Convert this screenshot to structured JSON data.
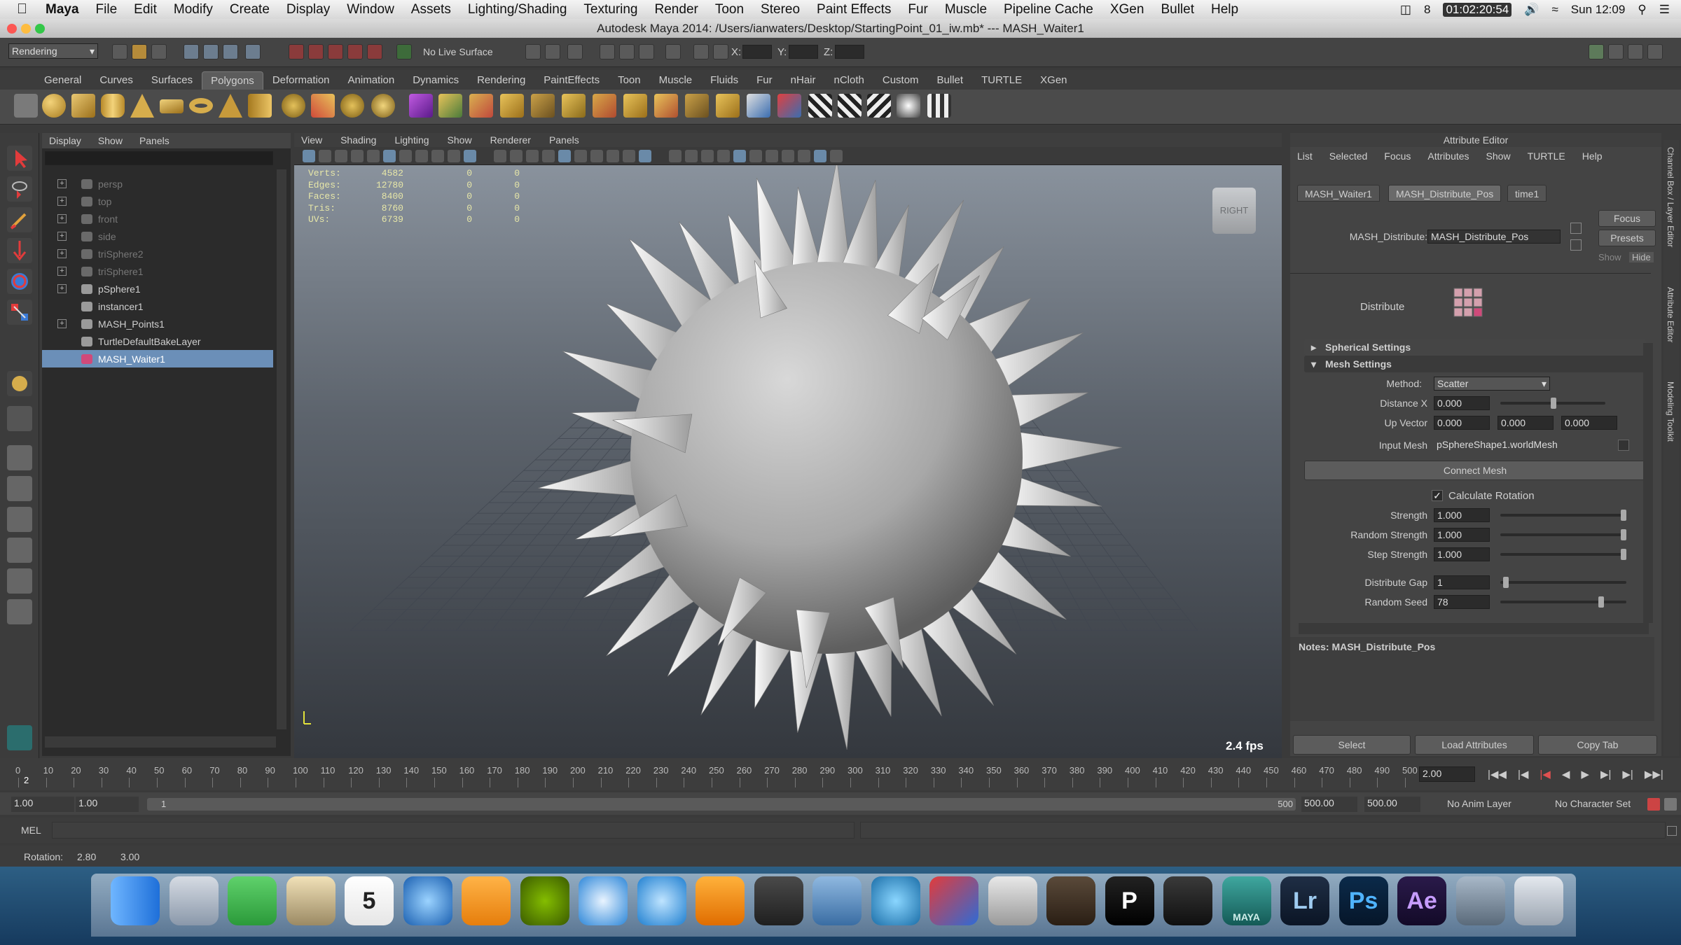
{
  "mac_menubar": {
    "apple_icon": "apple-icon",
    "items": [
      "Maya",
      "File",
      "Edit",
      "Modify",
      "Create",
      "Display",
      "Window",
      "Assets",
      "Lighting/Shading",
      "Texturing",
      "Render",
      "Toon",
      "Stereo",
      "Paint Effects",
      "Fur",
      "Muscle",
      "Pipeline Cache",
      "XGen",
      "Bullet",
      "Help"
    ],
    "status": {
      "badge": "8",
      "timer": "01:02:20:54",
      "clock": "Sun 12:09"
    }
  },
  "window_title": "Autodesk Maya 2014: /Users/ianwaters/Desktop/StartingPoint_01_iw.mb*   ---   MASH_Waiter1",
  "status_line": {
    "menuset": "Rendering",
    "live_surface": "No Live Surface",
    "x_label": "X:",
    "y_label": "Y:",
    "z_label": "Z:"
  },
  "shelf": {
    "tabs": [
      "General",
      "Curves",
      "Surfaces",
      "Polygons",
      "Deformation",
      "Animation",
      "Dynamics",
      "Rendering",
      "PaintEffects",
      "Toon",
      "Muscle",
      "Fluids",
      "Fur",
      "nHair",
      "nCloth",
      "Custom",
      "Bullet",
      "TURTLE",
      "XGen"
    ],
    "active_tab": "Polygons"
  },
  "outliner": {
    "menu": [
      "Display",
      "Show",
      "Panels"
    ],
    "items": [
      {
        "label": "persp",
        "expander": "+",
        "dim": true
      },
      {
        "label": "top",
        "expander": "+",
        "dim": true
      },
      {
        "label": "front",
        "expander": "+",
        "dim": true
      },
      {
        "label": "side",
        "expander": "+",
        "dim": true
      },
      {
        "label": "triSphere2",
        "expander": "+",
        "dim": true
      },
      {
        "label": "triSphere1",
        "expander": "+",
        "dim": true
      },
      {
        "label": "pSphere1",
        "expander": "+",
        "dim": false
      },
      {
        "label": "instancer1",
        "expander": "",
        "dim": false
      },
      {
        "label": "MASH_Points1",
        "expander": "+",
        "dim": false
      },
      {
        "label": "TurtleDefaultBakeLayer",
        "expander": "",
        "dim": false
      },
      {
        "label": "MASH_Waiter1",
        "expander": "",
        "dim": false,
        "selected": true
      }
    ]
  },
  "viewport": {
    "menu": [
      "View",
      "Shading",
      "Lighting",
      "Show",
      "Renderer",
      "Panels"
    ],
    "hud": [
      {
        "label": "Verts:",
        "v1": "4582",
        "v2": "0",
        "v3": "0"
      },
      {
        "label": "Edges:",
        "v1": "12780",
        "v2": "0",
        "v3": "0"
      },
      {
        "label": "Faces:",
        "v1": "8400",
        "v2": "0",
        "v3": "0"
      },
      {
        "label": "Tris:",
        "v1": "8760",
        "v2": "0",
        "v3": "0"
      },
      {
        "label": "UVs:",
        "v1": "6739",
        "v2": "0",
        "v3": "0"
      }
    ],
    "view_cube": "RIGHT",
    "fps": "2.4 fps"
  },
  "attribute_editor": {
    "title": "Attribute Editor",
    "menu": [
      "List",
      "Selected",
      "Focus",
      "Attributes",
      "Show",
      "TURTLE",
      "Help"
    ],
    "tabs": [
      "MASH_Waiter1",
      "MASH_Distribute_Pos",
      "time1"
    ],
    "active_tab": "MASH_Distribute_Pos",
    "node_label": "MASH_Distribute:",
    "node_value": "MASH_Distribute_Pos",
    "focus_btn": "Focus",
    "presets_btn": "Presets",
    "show_btn": "Show",
    "hide_btn": "Hide",
    "distribute_label": "Distribute",
    "spherical_section": "Spherical Settings",
    "mesh_section": "Mesh Settings",
    "method_label": "Method:",
    "method_value": "Scatter",
    "distance_label": "Distance X",
    "distance_value": "0.000",
    "upvector_label": "Up Vector",
    "upvector_values": [
      "0.000",
      "0.000",
      "0.000"
    ],
    "inputmesh_label": "Input Mesh",
    "inputmesh_value": "pSphereShape1.worldMesh",
    "connect_btn": "Connect Mesh",
    "calc_rotation": "Calculate Rotation",
    "strength_label": "Strength",
    "strength_value": "1.000",
    "randstrength_label": "Random Strength",
    "randstrength_value": "1.000",
    "stepstrength_label": "Step Strength",
    "stepstrength_value": "1.000",
    "gap_label": "Distribute Gap",
    "gap_value": "1",
    "seed_label": "Random Seed",
    "seed_value": "78",
    "notes": "Notes:  MASH_Distribute_Pos",
    "select_btn": "Select",
    "load_btn": "Load Attributes",
    "copy_btn": "Copy Tab"
  },
  "side_tabs": [
    "Channel Box / Layer Editor",
    "Attribute Editor",
    "Modeling Toolkit"
  ],
  "timeline": {
    "ticks": [
      "0",
      "10",
      "20",
      "30",
      "40",
      "50",
      "60",
      "70",
      "80",
      "90",
      "100",
      "110",
      "120",
      "130",
      "140",
      "150",
      "160",
      "170",
      "180",
      "190",
      "200",
      "210",
      "220",
      "230",
      "240",
      "250",
      "260",
      "270",
      "280",
      "290",
      "300",
      "310",
      "320",
      "330",
      "340",
      "350",
      "360",
      "370",
      "380",
      "390",
      "400",
      "410",
      "420",
      "430",
      "440",
      "450",
      "460",
      "470",
      "480",
      "490",
      "500"
    ],
    "current_frame": "2",
    "current_time": "2.00"
  },
  "range": {
    "start": "1.00",
    "start2": "1.00",
    "range_label": "1",
    "range_end_label": "500",
    "end": "500.00",
    "end2": "500.00",
    "anim_layer": "No Anim Layer",
    "char_set": "No Character Set"
  },
  "command_line": {
    "label": "MEL"
  },
  "help_line": {
    "label": "Rotation:",
    "v1": "2.80",
    "v2": "3.00"
  },
  "dock": {
    "items": [
      "finder-icon",
      "mail-icon",
      "evernote-icon",
      "photos-icon",
      "calendar-icon",
      "itunes-icon",
      "ibooks-icon",
      "spotify-icon",
      "safari-icon",
      "quicktime-icon",
      "vlc-icon",
      "sublime-icon",
      "xcode-icon",
      "maya-snowflake-icon",
      "vray-icon",
      "text-icon",
      "imovie-icon",
      "p-icon",
      "ink-icon",
      "maya-icon",
      "lightroom-icon",
      "photoshop-icon",
      "aftereffects-icon",
      "film-icon",
      "trash-icon"
    ],
    "calendar_day": "5",
    "maya_label": "MAYA",
    "lr_label": "Lr",
    "ps_label": "Ps",
    "ae_label": "Ae",
    "p_label": "P"
  }
}
